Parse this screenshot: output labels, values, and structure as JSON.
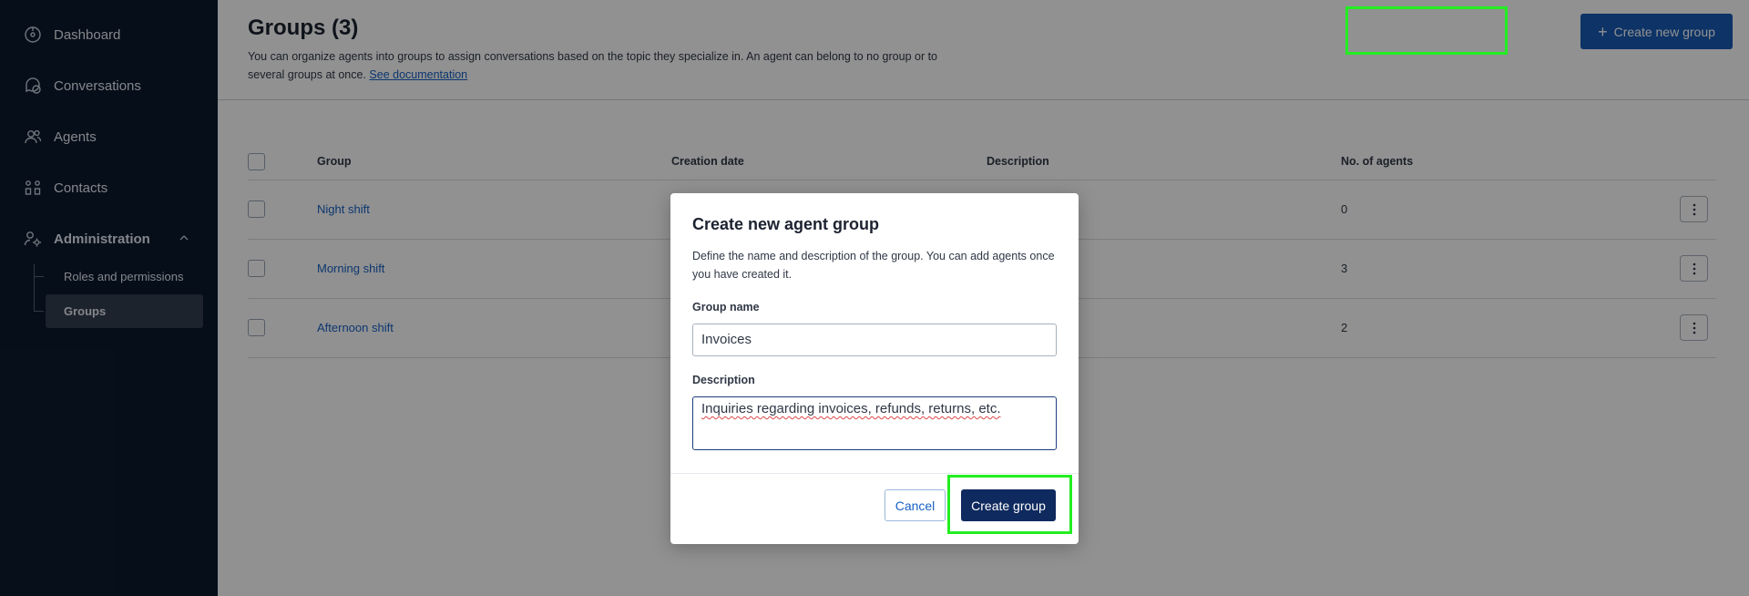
{
  "sidebar": {
    "items": [
      {
        "label": "Dashboard",
        "icon": "dashboard-icon"
      },
      {
        "label": "Conversations",
        "icon": "conversations-icon"
      },
      {
        "label": "Agents",
        "icon": "agents-icon"
      },
      {
        "label": "Contacts",
        "icon": "contacts-icon"
      },
      {
        "label": "Administration",
        "icon": "administration-icon",
        "expanded": true
      }
    ],
    "sub_items": [
      {
        "label": "Roles and permissions",
        "active": false
      },
      {
        "label": "Groups",
        "active": true
      }
    ]
  },
  "page": {
    "title": "Groups (3)",
    "description": "You can organize agents into groups to assign conversations based on the topic they specialize in. An agent can belong to no group or to several groups at once. ",
    "doc_link": "See documentation",
    "create_button": "Create new group"
  },
  "table": {
    "columns": [
      "Group",
      "Creation date",
      "Description",
      "No. of agents"
    ],
    "rows": [
      {
        "group": "Night shift",
        "creation_date": "",
        "description": "",
        "agents": "0"
      },
      {
        "group": "Morning shift",
        "creation_date": "",
        "description": "",
        "agents": "3"
      },
      {
        "group": "Afternoon shift",
        "creation_date": "",
        "description": "",
        "agents": "2"
      }
    ]
  },
  "modal": {
    "title": "Create new agent group",
    "description": "Define the name and description of the group. You can add agents once you have created it.",
    "name_label": "Group name",
    "name_value": "Invoices",
    "description_label": "Description",
    "description_value": "Inquiries regarding invoices, refunds, returns, etc.",
    "cancel": "Cancel",
    "submit": "Create group"
  },
  "colors": {
    "sidebar_bg": "#0b1a2e",
    "primary": "#175bb5",
    "modal_primary": "#0f2a5e",
    "link": "#1761c4",
    "highlight": "#22ee22"
  }
}
